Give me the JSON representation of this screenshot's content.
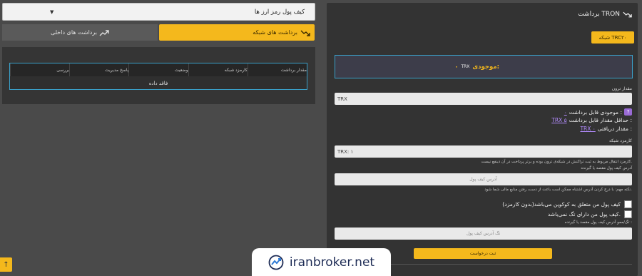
{
  "left": {
    "wallet_select": "کیف پول رمز ارز ها",
    "tab_network": "برداشت های شبکه",
    "tab_internal": "برداشت های داخلی",
    "table": {
      "columns": [
        "مقدار برداشت",
        "کارمزد شبکه",
        "وضعیت",
        "پاسخ مدیریت",
        "بررسی"
      ],
      "empty_text": "فاقد داده"
    }
  },
  "right": {
    "title": "برداشت TRON",
    "network_badge": "شبکه TRC۲۰",
    "balance_label": "موجودی:",
    "balance_unit": "TRX",
    "balance_value": "۰",
    "amount_label": "مقدار ترون",
    "amount_value": "TRX",
    "withdrawable_label": "موجودی قابل برداشت :",
    "withdrawable_value": "۰",
    "min_label": "حداقل مقدار قابل برداشت :",
    "min_value": "TRX ۵",
    "receive_label": "مقدار دریافتی :",
    "receive_value": "TRX ۰",
    "fee_label": "کارمزد شبکه",
    "fee_value": "TRX: ۱",
    "fee_note": "کارمزد انتقال مربوط به ثبت تراکنش در شبکه‌ی ترون بوده و برتر پرداخت در آن ذینفع نیست.",
    "address_label": "آدرس کیف پول مقصد یا گیرنده",
    "address_placeholder": "آدرس کیف پول",
    "address_note": "نکته مهم: با درج کردن آدرس اشتباه ممکن است باعث از دست رفتن منابع مالی شما شود.",
    "check_coinbase": "کیف پول من متعلق به کوکوین می‌باشد(بدون کارمزد)",
    "check_tag": "کیف پول من دارای تگ نمی‌باشد.",
    "tag_label": "تگ/ممو آدرس کیف پول مقصد یا گیرنده :",
    "tag_placeholder": "تگ آدرس کیف پول",
    "submit": "ثبت درخواست"
  },
  "watermark": "iranbroker.net",
  "colors": {
    "accent": "#f4b81c",
    "border_blue": "#3aa0c8",
    "link_purple": "#b48cff"
  }
}
